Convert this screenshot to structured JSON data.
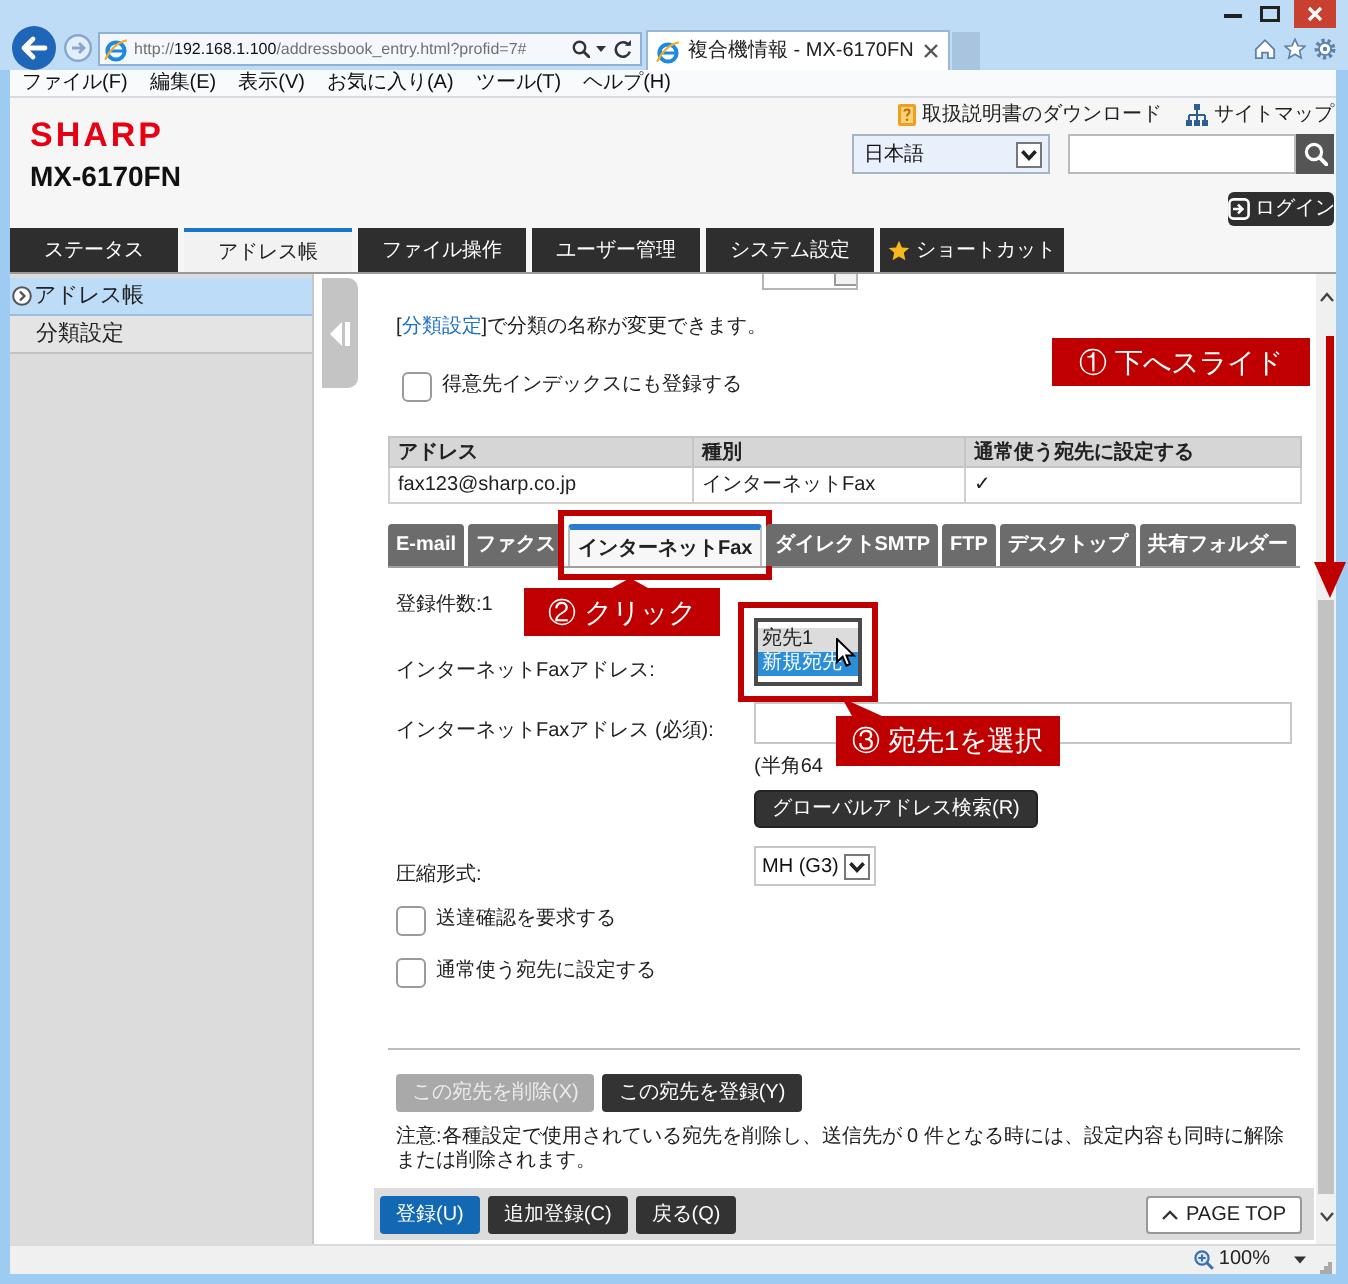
{
  "browser": {
    "address": {
      "scheme": "http://",
      "host": "192.168.1.100",
      "path": "/addressbook_entry.html?profid=7#"
    },
    "tabs": [
      {
        "label": "複合機情報 - MX-6170FN",
        "selected": true
      }
    ],
    "menu": [
      "ファイル(F)",
      "編集(E)",
      "表示(V)",
      "お気に入り(A)",
      "ツール(T)",
      "ヘルプ(H)"
    ],
    "zoom": "100%"
  },
  "header": {
    "logo": "SHARP",
    "model": "MX-6170FN",
    "manual_link": "取扱説明書のダウンロード",
    "sitemap_link": "サイトマップ",
    "language": "日本語",
    "login": "ログイン"
  },
  "main_tabs": [
    {
      "label": "ステータス",
      "selected": false,
      "kind": "plain"
    },
    {
      "label": "アドレス帳",
      "selected": true,
      "kind": "plain"
    },
    {
      "label": "ファイル操作",
      "selected": false,
      "kind": "plain"
    },
    {
      "label": "ユーザー管理",
      "selected": false,
      "kind": "plain"
    },
    {
      "label": "システム設定",
      "selected": false,
      "kind": "plain"
    },
    {
      "label": "ショートカット",
      "selected": false,
      "kind": "shortcut"
    }
  ],
  "sidebar": {
    "items": [
      {
        "label": "アドレス帳",
        "selected": true
      },
      {
        "label": "分類設定",
        "selected": false
      }
    ]
  },
  "content": {
    "category_note": {
      "before": "[",
      "link": "分類設定",
      "after": "]で分類の名称が変更できます。"
    },
    "index_checkbox": {
      "label": "得意先インデックスにも登録する",
      "checked": false
    },
    "table": {
      "columns": [
        "アドレス",
        "種別",
        "通常使う宛先に設定する"
      ],
      "rows": [
        [
          "fax123@sharp.co.jp",
          "インターネットFax",
          "✓"
        ]
      ]
    },
    "type_tabs": [
      {
        "label": "E-mail",
        "selected": false
      },
      {
        "label": "ファクス",
        "selected": false
      },
      {
        "label": "インターネットFax",
        "selected": true
      },
      {
        "label": "ダイレクトSMTP",
        "selected": false
      },
      {
        "label": "FTP",
        "selected": false
      },
      {
        "label": "デスクトップ",
        "selected": false
      },
      {
        "label": "共有フォルダー",
        "selected": false
      }
    ],
    "count": "登録件数:1",
    "address_select": {
      "label": "インターネットFaxアドレス:",
      "options": [
        {
          "label": "宛先1",
          "selected": false,
          "hovered": true
        },
        {
          "label": "新規宛先",
          "selected": true,
          "hovered": false
        }
      ]
    },
    "address_input": {
      "label": "インターネットFaxアドレス (必須):",
      "hint": "(半角64"
    },
    "global_search_button": "グローバルアドレス検索(R)",
    "compression": {
      "label": "圧縮形式:",
      "value": "MH (G3)"
    },
    "checkboxes": [
      {
        "label": "送達確認を要求する",
        "checked": false
      },
      {
        "label": "通常使う宛先に設定する",
        "checked": false
      }
    ],
    "entry_buttons": [
      {
        "label": "この宛先を削除(X)",
        "disabled": true
      },
      {
        "label": "この宛先を登録(Y)",
        "disabled": false
      }
    ],
    "note": "注意:各種設定で使用されている宛先を削除し、送信先が 0 件となる時には、設定内容も同時に解除または削除されます。"
  },
  "footer_buttons": [
    {
      "label": "登録(U)",
      "kind": "primary"
    },
    {
      "label": "追加登録(C)",
      "kind": "secondary"
    },
    {
      "label": "戻る(Q)",
      "kind": "secondary"
    }
  ],
  "page_top": "PAGE TOP",
  "annotations": [
    {
      "label": "① 下へスライド"
    },
    {
      "label": "② クリック"
    },
    {
      "label": "③ 宛先1を選択"
    }
  ]
}
